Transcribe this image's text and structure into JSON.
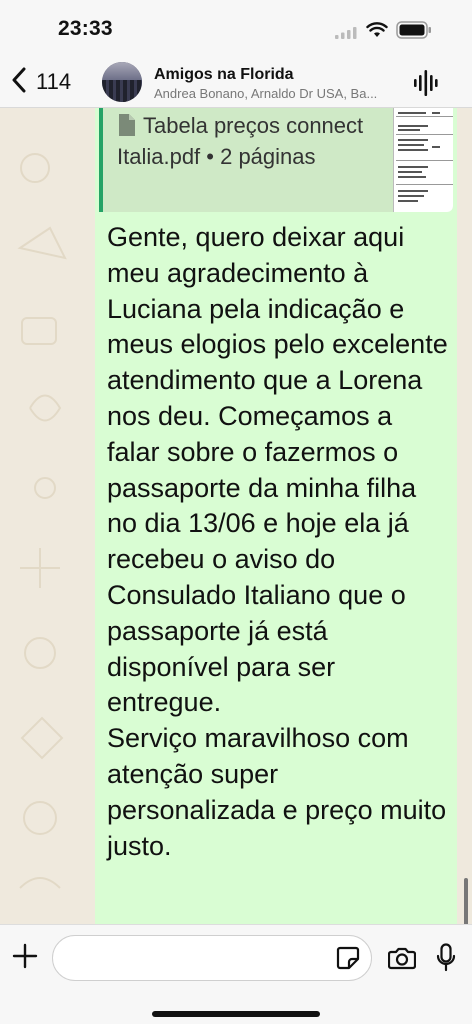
{
  "status_bar": {
    "time": "23:33"
  },
  "header": {
    "back_count": "114",
    "title": "Amigos na Florida",
    "subtitle": "Andrea Bonano, Arnaldo Dr USA, Ba..."
  },
  "message": {
    "attachment": {
      "name": "Tabela preços connect Italia.pdf • 2 páginas",
      "icon": "document-icon"
    },
    "text": "Gente, quero deixar aqui meu agradecimento à Luciana pela indicação e meus elogios pelo excelente atendimento que a Lorena nos deu. Começamos a falar sobre o fazermos o passaporte da minha filha no dia 13/06 e hoje ela já recebeu o aviso do Consulado Italiano que o passaporte já está disponível para ser entregue.\nServiço maravilhoso com atenção super personalizada e preço muito justo."
  },
  "input_bar": {
    "placeholder": "",
    "icons": [
      "plus-icon",
      "sticker-icon",
      "camera-icon",
      "microphone-icon"
    ]
  },
  "colors": {
    "bubble": "#d9fdd3",
    "accent": "#25a366",
    "background": "#efe9dd"
  }
}
